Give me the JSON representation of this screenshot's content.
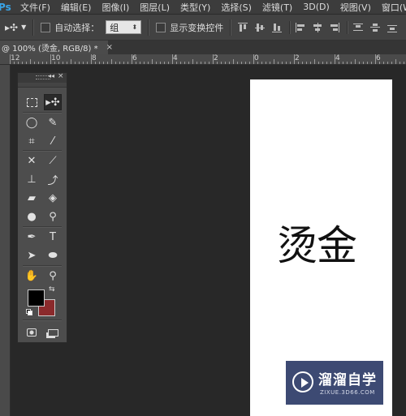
{
  "app": {
    "logo": "Ps"
  },
  "menu": {
    "items": [
      "文件(F)",
      "编辑(E)",
      "图像(I)",
      "图层(L)",
      "类型(Y)",
      "选择(S)",
      "滤镜(T)",
      "3D(D)",
      "视图(V)",
      "窗口(W)"
    ]
  },
  "options": {
    "tool_icon": "move-tool-icon",
    "auto_select_label": "自动选择：",
    "auto_select_value": "组",
    "show_transform_label": "显示变换控件"
  },
  "document": {
    "tab_title": "@ 100% (烫金, RGB/8) *",
    "close": "×",
    "canvas_text": "烫金"
  },
  "ruler": {
    "labels": [
      "12",
      "10",
      "8",
      "6",
      "4",
      "2",
      "0",
      "2",
      "4",
      "6"
    ]
  },
  "tools_panel": {
    "collapse": "◂◂",
    "close": "×",
    "colors": {
      "foreground": "#000000",
      "background": "#8b2a2c"
    }
  },
  "watermark": {
    "title": "溜溜自学",
    "subtitle": "ZIXUE.3D66.COM"
  }
}
